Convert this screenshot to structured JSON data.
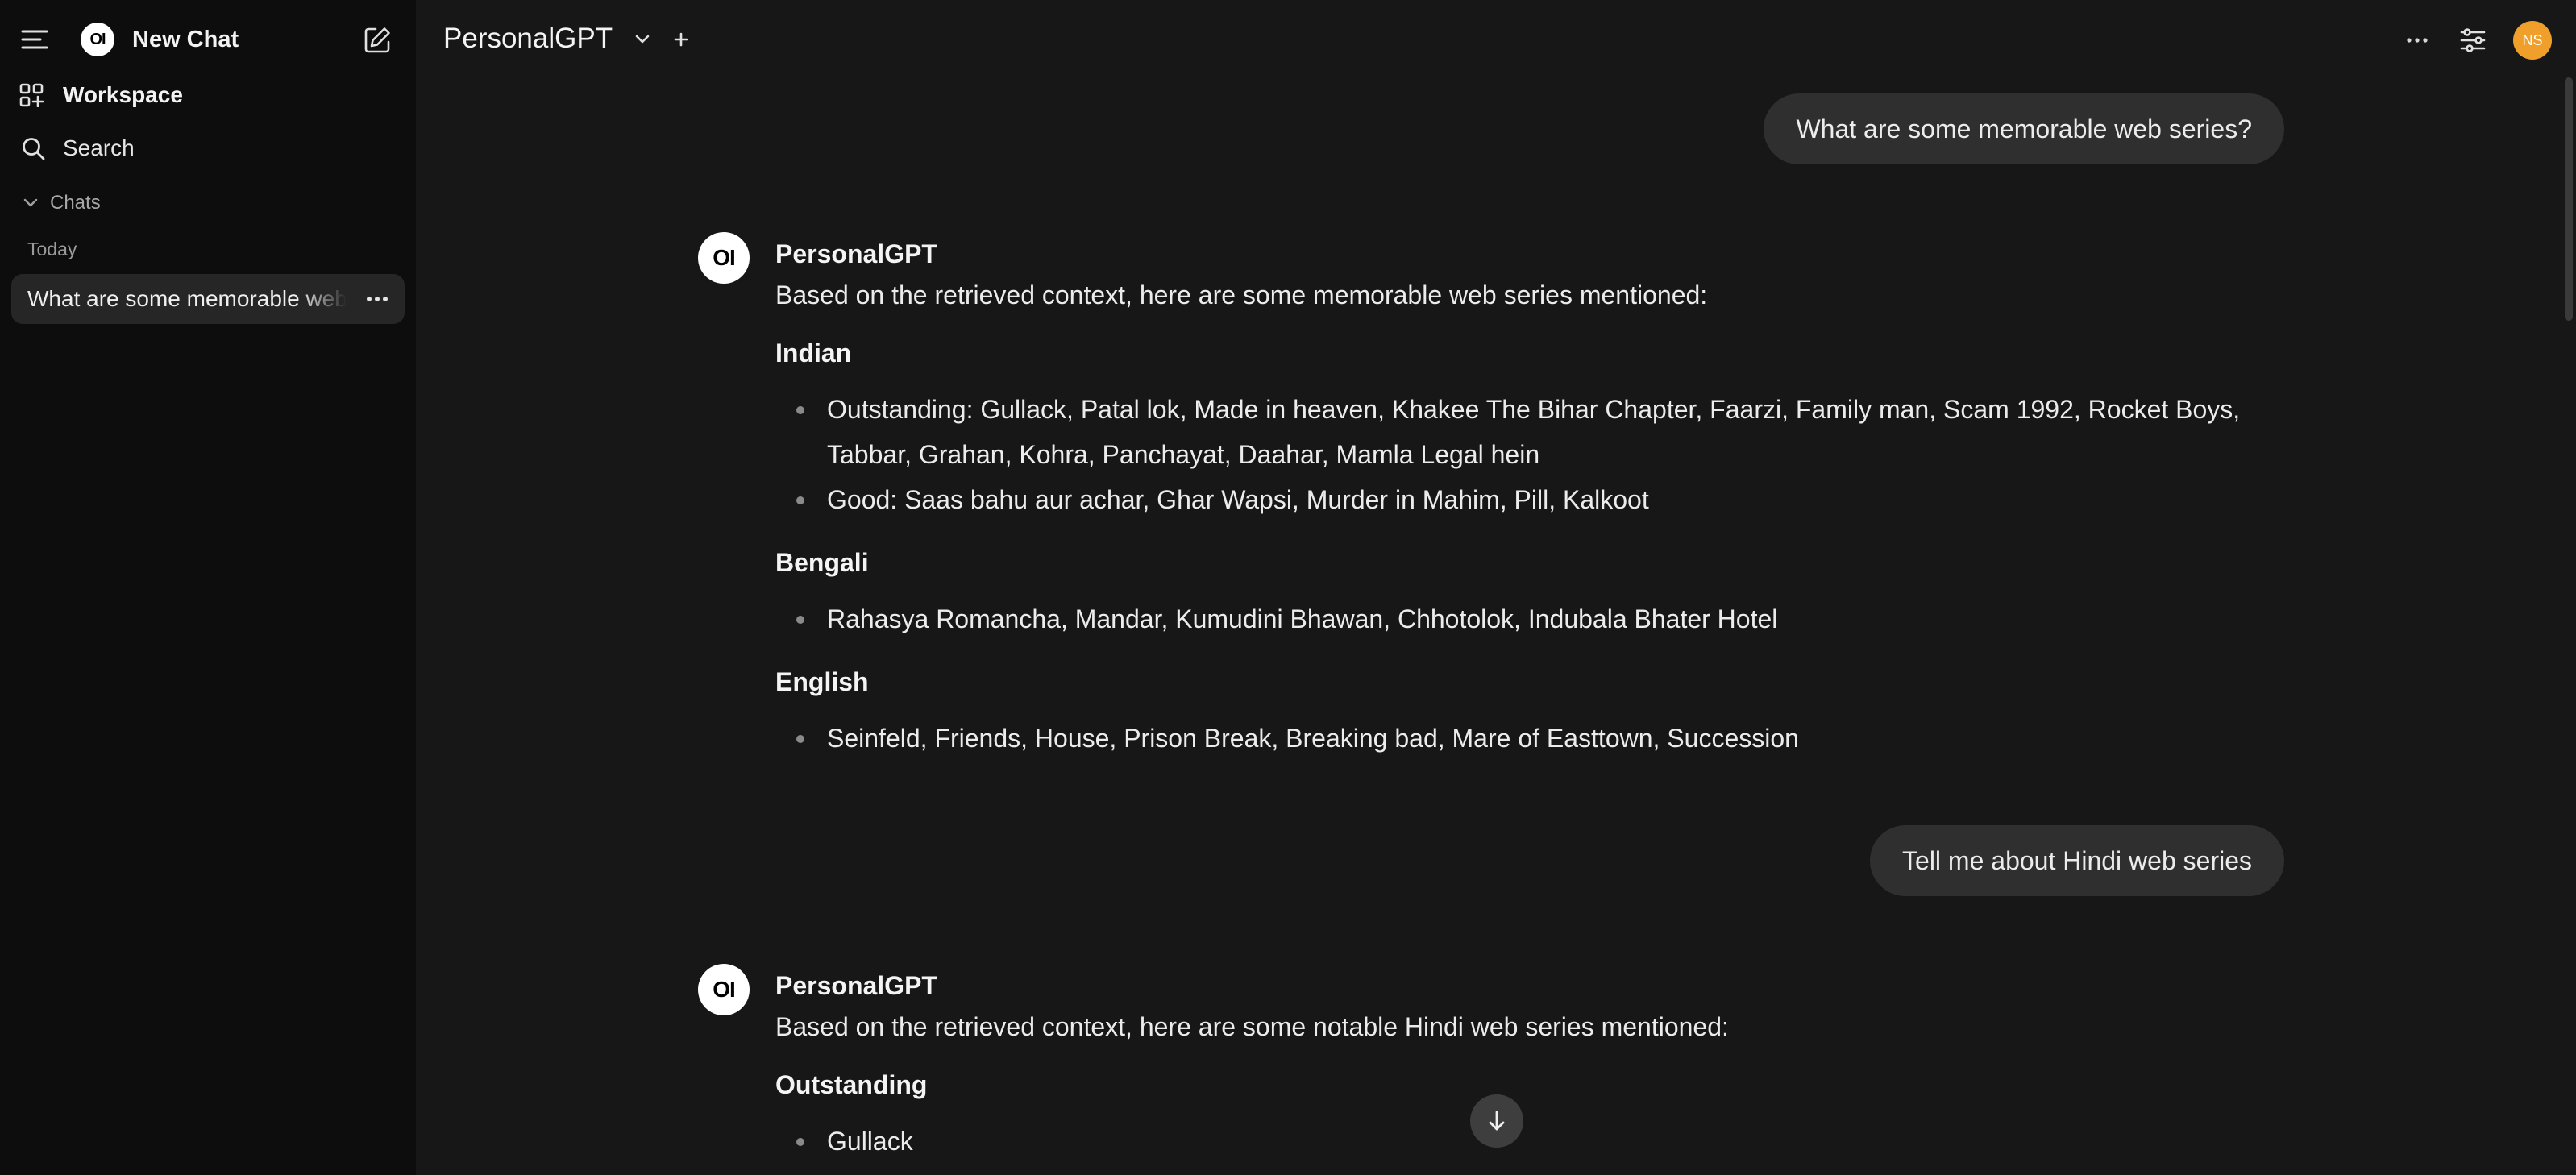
{
  "sidebar": {
    "logo_text": "OI",
    "new_chat_label": "New Chat",
    "workspace_label": "Workspace",
    "search_label": "Search",
    "chats_section_label": "Chats",
    "today_label": "Today",
    "chat_items": [
      {
        "title": "What are some memorable web series?"
      }
    ],
    "icons": {
      "menu": "menu-icon",
      "compose": "compose-icon",
      "workspace": "workspace-grid-icon",
      "search": "search-icon",
      "chevron": "chevron-down-icon",
      "more": "more-horizontal-icon"
    }
  },
  "header": {
    "model_name": "PersonalGPT",
    "avatar_initials": "NS",
    "avatar_color": "#f0a02a"
  },
  "conversation": {
    "messages": [
      {
        "role": "user",
        "text": "What are some memorable web series?"
      },
      {
        "role": "assistant",
        "avatar_text": "OI",
        "name": "PersonalGPT",
        "intro": "Based on the retrieved context, here are some memorable web series mentioned:",
        "sections": [
          {
            "heading": "Indian",
            "items": [
              "Outstanding: Gullack, Patal lok, Made in heaven, Khakee The Bihar Chapter, Faarzi, Family man, Scam 1992, Rocket Boys, Tabbar, Grahan, Kohra, Panchayat, Daahar, Mamla Legal hein",
              "Good: Saas bahu aur achar, Ghar Wapsi, Murder in Mahim, Pill, Kalkoot"
            ]
          },
          {
            "heading": "Bengali",
            "items": [
              "Rahasya Romancha, Mandar, Kumudini Bhawan, Chhotolok, Indubala Bhater Hotel"
            ]
          },
          {
            "heading": "English",
            "items": [
              "Seinfeld, Friends, House, Prison Break, Breaking bad, Mare of Easttown, Succession"
            ]
          }
        ]
      },
      {
        "role": "user",
        "text": "Tell me about Hindi web series"
      },
      {
        "role": "assistant",
        "avatar_text": "OI",
        "name": "PersonalGPT",
        "intro": "Based on the retrieved context, here are some notable Hindi web series mentioned:",
        "sections": [
          {
            "heading": "Outstanding",
            "items": [
              "Gullack"
            ]
          }
        ]
      }
    ]
  },
  "colors": {
    "background": "#171717",
    "sidebar": "#0d0d0d",
    "bubble": "#2f2f2f"
  }
}
